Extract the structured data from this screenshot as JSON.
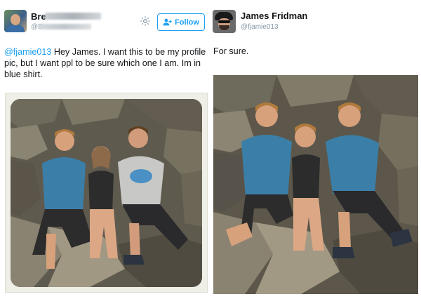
{
  "left_tweet": {
    "display_name_visible": "Bre",
    "handle_visible": "@B",
    "follow_label": "Follow",
    "mention": "@fjamie013",
    "body": " Hey James. I want this to be my profile pic, but I want ppl to be sure which one I am. Im in blue shirt."
  },
  "right_tweet": {
    "display_name": "James Fridman",
    "handle": "@fjamie013",
    "body": "For sure."
  },
  "colors": {
    "twitter_blue": "#1da1f2",
    "muted_text": "#8899a6",
    "blue_shirt": "#3b7fa8",
    "grey_shirt": "#c8c9c6"
  },
  "icons": [
    "settings-gear-icon",
    "follow-person-icon"
  ]
}
